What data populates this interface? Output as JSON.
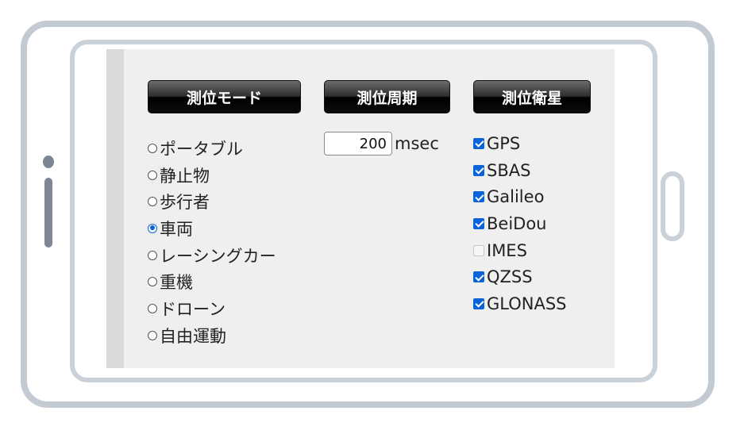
{
  "sections": {
    "mode": {
      "title": "測位モード",
      "options": [
        {
          "label": "ポータブル",
          "selected": false
        },
        {
          "label": "静止物",
          "selected": false
        },
        {
          "label": "歩行者",
          "selected": false
        },
        {
          "label": "車両",
          "selected": true
        },
        {
          "label": "レーシングカー",
          "selected": false
        },
        {
          "label": "重機",
          "selected": false
        },
        {
          "label": "ドローン",
          "selected": false
        },
        {
          "label": "自由運動",
          "selected": false
        }
      ]
    },
    "period": {
      "title": "測位周期",
      "value": "200",
      "unit": "msec"
    },
    "satellites": {
      "title": "測位衛星",
      "items": [
        {
          "label": "GPS",
          "checked": true
        },
        {
          "label": "SBAS",
          "checked": true
        },
        {
          "label": "Galileo",
          "checked": true
        },
        {
          "label": "BeiDou",
          "checked": true
        },
        {
          "label": "IMES",
          "checked": false
        },
        {
          "label": "QZSS",
          "checked": true
        },
        {
          "label": "GLONASS",
          "checked": true
        }
      ]
    }
  },
  "colors": {
    "accent": "#0a64d8",
    "frame": "#c3cad2",
    "screen_background": "#efefef",
    "header_background": "#1a1a1a"
  }
}
